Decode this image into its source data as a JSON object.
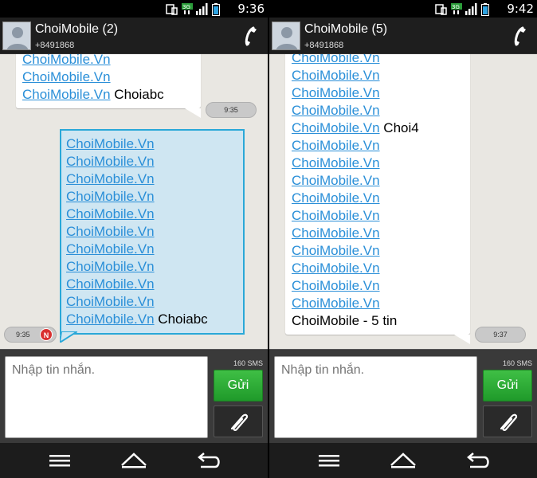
{
  "left": {
    "status": {
      "time": "9:36"
    },
    "header": {
      "name": "ChoiMobile (2)",
      "number": "+8491868"
    },
    "messages": {
      "incoming_lines": [
        "ChoiMobile.Vn",
        "ChoiMobile.Vn",
        "ChoiMobile.Vn"
      ],
      "incoming_tail": "Choiabc",
      "incoming_time": "9:35",
      "outgoing_lines": [
        "ChoiMobile.Vn",
        "ChoiMobile.Vn",
        "ChoiMobile.Vn",
        "ChoiMobile.Vn",
        "ChoiMobile.Vn",
        "ChoiMobile.Vn",
        "ChoiMobile.Vn",
        "ChoiMobile.Vn",
        "ChoiMobile.Vn",
        "ChoiMobile.Vn",
        "ChoiMobile.Vn"
      ],
      "outgoing_tail": "Choiabc",
      "outgoing_time": "9:35",
      "badge": "N"
    },
    "compose": {
      "placeholder": "Nhập tin nhắn.",
      "sms_count": "160 SMS",
      "send_label": "Gửi"
    }
  },
  "right": {
    "status": {
      "time": "9:42"
    },
    "header": {
      "name": "ChoiMobile (5)",
      "number": "+8491868"
    },
    "messages": {
      "lines_before": [
        "ChoiMobile.Vn",
        "ChoiMobile.Vn",
        "ChoiMobile.Vn",
        "ChoiMobile.Vn"
      ],
      "mid_link": "ChoiMobile.Vn",
      "mid_tail": "Choi4",
      "lines_after": [
        "ChoiMobile.Vn",
        "ChoiMobile.Vn",
        "ChoiMobile.Vn",
        "ChoiMobile.Vn",
        "ChoiMobile.Vn",
        "ChoiMobile.Vn",
        "ChoiMobile.Vn",
        "ChoiMobile.Vn",
        "ChoiMobile.Vn",
        "ChoiMobile.Vn"
      ],
      "footer": "ChoiMobile - 5 tin",
      "time": "9:37"
    },
    "compose": {
      "placeholder": "Nhập tin nhắn.",
      "sms_count": "160 SMS",
      "send_label": "Gửi"
    }
  },
  "colors": {
    "link": "#2a8fd8",
    "send": "#2fae38",
    "outgoing_border": "#2aa8d8",
    "outgoing_bg": "#cfe6f2"
  },
  "icons": [
    "phone-icon",
    "signal-icon",
    "battery-icon",
    "3g-icon",
    "screen-icon",
    "menu-icon",
    "home-icon",
    "back-icon",
    "attach-icon"
  ]
}
